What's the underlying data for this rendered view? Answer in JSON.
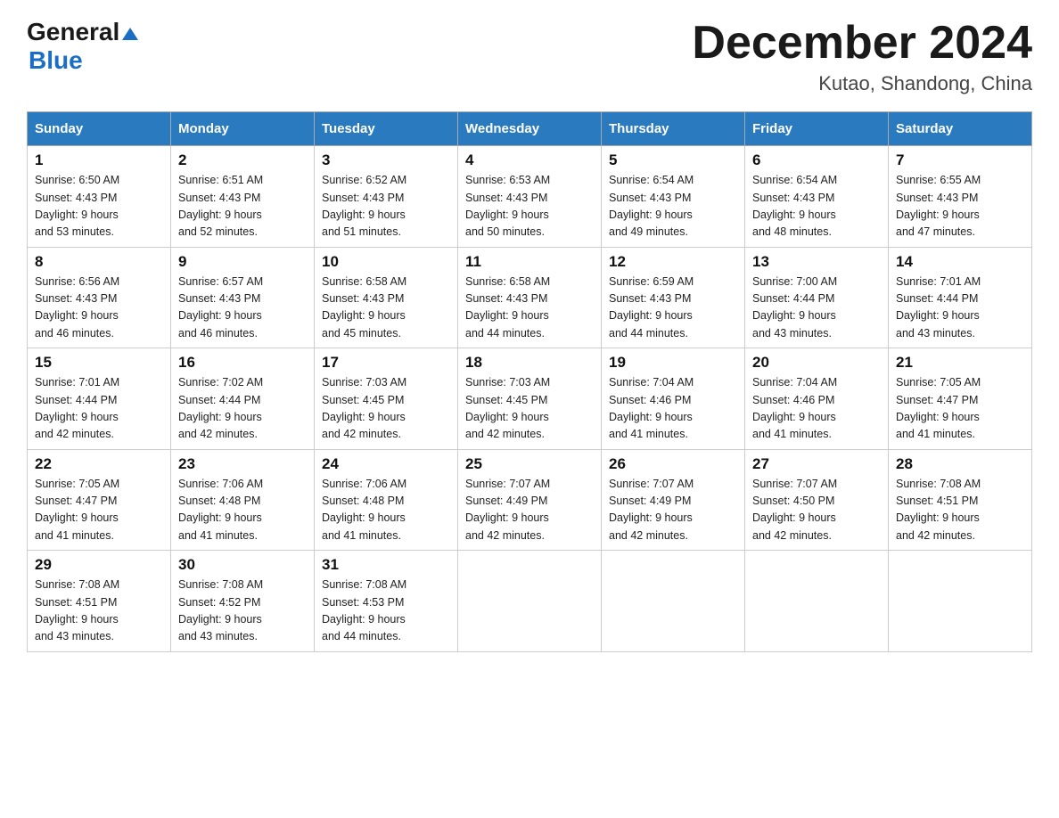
{
  "logo": {
    "general": "General",
    "blue": "Blue",
    "triangle": "▶"
  },
  "title": "December 2024",
  "location": "Kutao, Shandong, China",
  "headers": [
    "Sunday",
    "Monday",
    "Tuesday",
    "Wednesday",
    "Thursday",
    "Friday",
    "Saturday"
  ],
  "weeks": [
    [
      {
        "day": "1",
        "sunrise": "6:50 AM",
        "sunset": "4:43 PM",
        "daylight": "9 hours and 53 minutes."
      },
      {
        "day": "2",
        "sunrise": "6:51 AM",
        "sunset": "4:43 PM",
        "daylight": "9 hours and 52 minutes."
      },
      {
        "day": "3",
        "sunrise": "6:52 AM",
        "sunset": "4:43 PM",
        "daylight": "9 hours and 51 minutes."
      },
      {
        "day": "4",
        "sunrise": "6:53 AM",
        "sunset": "4:43 PM",
        "daylight": "9 hours and 50 minutes."
      },
      {
        "day": "5",
        "sunrise": "6:54 AM",
        "sunset": "4:43 PM",
        "daylight": "9 hours and 49 minutes."
      },
      {
        "day": "6",
        "sunrise": "6:54 AM",
        "sunset": "4:43 PM",
        "daylight": "9 hours and 48 minutes."
      },
      {
        "day": "7",
        "sunrise": "6:55 AM",
        "sunset": "4:43 PM",
        "daylight": "9 hours and 47 minutes."
      }
    ],
    [
      {
        "day": "8",
        "sunrise": "6:56 AM",
        "sunset": "4:43 PM",
        "daylight": "9 hours and 46 minutes."
      },
      {
        "day": "9",
        "sunrise": "6:57 AM",
        "sunset": "4:43 PM",
        "daylight": "9 hours and 46 minutes."
      },
      {
        "day": "10",
        "sunrise": "6:58 AM",
        "sunset": "4:43 PM",
        "daylight": "9 hours and 45 minutes."
      },
      {
        "day": "11",
        "sunrise": "6:58 AM",
        "sunset": "4:43 PM",
        "daylight": "9 hours and 44 minutes."
      },
      {
        "day": "12",
        "sunrise": "6:59 AM",
        "sunset": "4:43 PM",
        "daylight": "9 hours and 44 minutes."
      },
      {
        "day": "13",
        "sunrise": "7:00 AM",
        "sunset": "4:44 PM",
        "daylight": "9 hours and 43 minutes."
      },
      {
        "day": "14",
        "sunrise": "7:01 AM",
        "sunset": "4:44 PM",
        "daylight": "9 hours and 43 minutes."
      }
    ],
    [
      {
        "day": "15",
        "sunrise": "7:01 AM",
        "sunset": "4:44 PM",
        "daylight": "9 hours and 42 minutes."
      },
      {
        "day": "16",
        "sunrise": "7:02 AM",
        "sunset": "4:44 PM",
        "daylight": "9 hours and 42 minutes."
      },
      {
        "day": "17",
        "sunrise": "7:03 AM",
        "sunset": "4:45 PM",
        "daylight": "9 hours and 42 minutes."
      },
      {
        "day": "18",
        "sunrise": "7:03 AM",
        "sunset": "4:45 PM",
        "daylight": "9 hours and 42 minutes."
      },
      {
        "day": "19",
        "sunrise": "7:04 AM",
        "sunset": "4:46 PM",
        "daylight": "9 hours and 41 minutes."
      },
      {
        "day": "20",
        "sunrise": "7:04 AM",
        "sunset": "4:46 PM",
        "daylight": "9 hours and 41 minutes."
      },
      {
        "day": "21",
        "sunrise": "7:05 AM",
        "sunset": "4:47 PM",
        "daylight": "9 hours and 41 minutes."
      }
    ],
    [
      {
        "day": "22",
        "sunrise": "7:05 AM",
        "sunset": "4:47 PM",
        "daylight": "9 hours and 41 minutes."
      },
      {
        "day": "23",
        "sunrise": "7:06 AM",
        "sunset": "4:48 PM",
        "daylight": "9 hours and 41 minutes."
      },
      {
        "day": "24",
        "sunrise": "7:06 AM",
        "sunset": "4:48 PM",
        "daylight": "9 hours and 41 minutes."
      },
      {
        "day": "25",
        "sunrise": "7:07 AM",
        "sunset": "4:49 PM",
        "daylight": "9 hours and 42 minutes."
      },
      {
        "day": "26",
        "sunrise": "7:07 AM",
        "sunset": "4:49 PM",
        "daylight": "9 hours and 42 minutes."
      },
      {
        "day": "27",
        "sunrise": "7:07 AM",
        "sunset": "4:50 PM",
        "daylight": "9 hours and 42 minutes."
      },
      {
        "day": "28",
        "sunrise": "7:08 AM",
        "sunset": "4:51 PM",
        "daylight": "9 hours and 42 minutes."
      }
    ],
    [
      {
        "day": "29",
        "sunrise": "7:08 AM",
        "sunset": "4:51 PM",
        "daylight": "9 hours and 43 minutes."
      },
      {
        "day": "30",
        "sunrise": "7:08 AM",
        "sunset": "4:52 PM",
        "daylight": "9 hours and 43 minutes."
      },
      {
        "day": "31",
        "sunrise": "7:08 AM",
        "sunset": "4:53 PM",
        "daylight": "9 hours and 44 minutes."
      },
      null,
      null,
      null,
      null
    ]
  ]
}
